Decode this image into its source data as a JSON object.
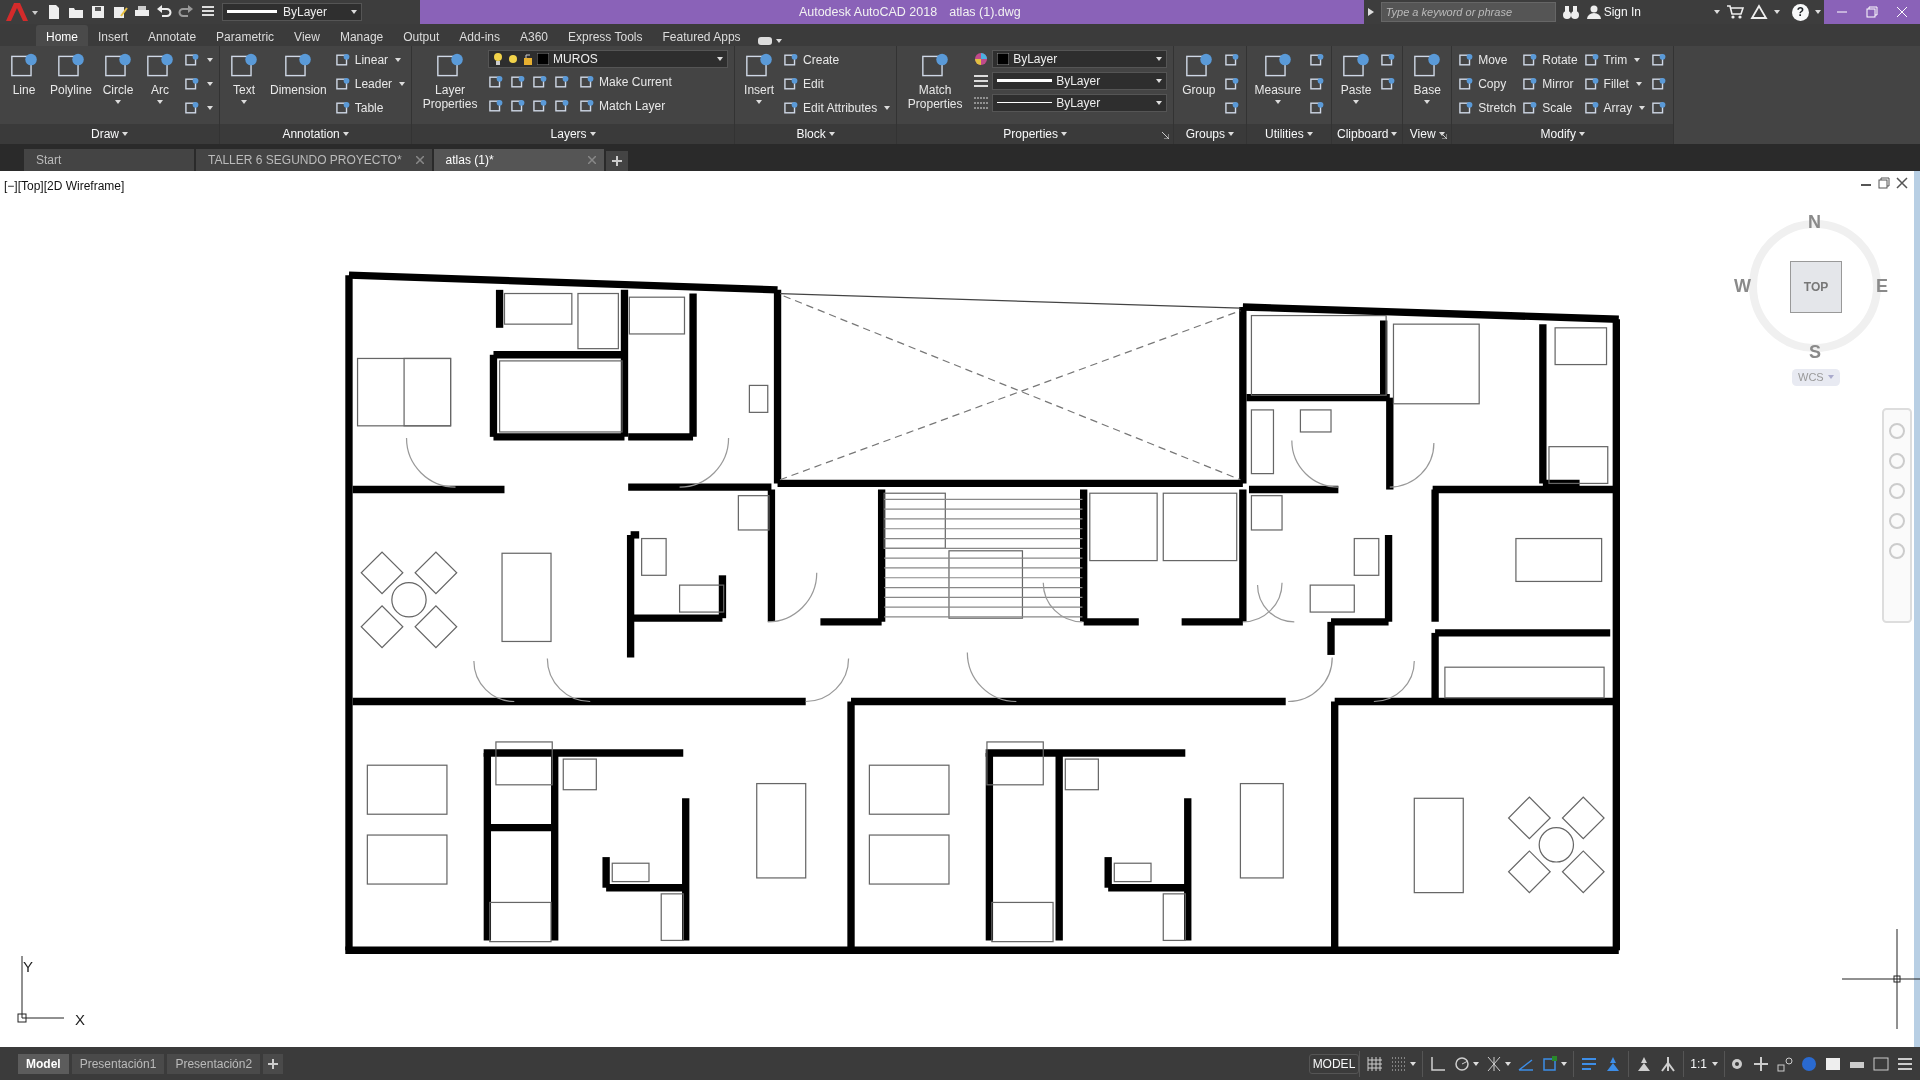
{
  "title_bar": {
    "layer_combo": "ByLayer",
    "app": "Autodesk AutoCAD 2018",
    "file": "atlas (1).dwg",
    "search": {
      "placeholder": "Type a keyword or phrase"
    },
    "sign_in": "Sign In",
    "help": "?"
  },
  "ribbon_tabs": [
    {
      "label": "Home",
      "selected": true
    },
    {
      "label": "Insert",
      "selected": false
    },
    {
      "label": "Annotate",
      "selected": false
    },
    {
      "label": "Parametric",
      "selected": false
    },
    {
      "label": "View",
      "selected": false
    },
    {
      "label": "Manage",
      "selected": false
    },
    {
      "label": "Output",
      "selected": false
    },
    {
      "label": "Add-ins",
      "selected": false
    },
    {
      "label": "A360",
      "selected": false
    },
    {
      "label": "Express Tools",
      "selected": false
    },
    {
      "label": "Featured Apps",
      "selected": false
    }
  ],
  "panels": [
    {
      "title": "Draw",
      "launcher": false,
      "columns": [
        {
          "kind": "large",
          "label": "Line",
          "dropdown": false
        },
        {
          "kind": "large",
          "label": "Polyline",
          "dropdown": false
        },
        {
          "kind": "large",
          "label": "Circle",
          "dropdown": true
        },
        {
          "kind": "large",
          "label": "Arc",
          "dropdown": true
        },
        {
          "kind": "stack",
          "items": [
            {
              "dropdown": true
            },
            {
              "dropdown": true
            },
            {
              "dropdown": true
            }
          ]
        }
      ]
    },
    {
      "title": "Annotation",
      "launcher": false,
      "columns": [
        {
          "kind": "large",
          "label": "Text",
          "dropdown": true
        },
        {
          "kind": "large",
          "label": "Dimension",
          "dropdown": false
        },
        {
          "kind": "stack",
          "items": [
            {
              "label": "Linear",
              "dropdown": true
            },
            {
              "label": "Leader",
              "dropdown": true
            },
            {
              "label": "Table",
              "dropdown": false
            }
          ]
        }
      ]
    },
    {
      "title": "Layers",
      "launcher": false,
      "columns": [
        {
          "kind": "large",
          "label": "Layer Properties",
          "dropdown": false
        },
        {
          "kind": "layers",
          "combo": "MUROS",
          "items": [
            {
              "label": "Make Current"
            },
            {
              "label": "Match Layer"
            }
          ]
        }
      ]
    },
    {
      "title": "Block",
      "launcher": false,
      "columns": [
        {
          "kind": "large",
          "label": "Insert",
          "dropdown": true
        },
        {
          "kind": "stack",
          "items": [
            {
              "label": "Create",
              "dropdown": false
            },
            {
              "label": "Edit",
              "dropdown": false
            },
            {
              "label": "Edit Attributes",
              "dropdown": true
            }
          ]
        }
      ]
    },
    {
      "title": "Properties",
      "launcher": true,
      "columns": [
        {
          "kind": "large",
          "label": "Match Properties",
          "dropdown": false
        },
        {
          "kind": "props",
          "combos": [
            {
              "kind": "color",
              "value": "ByLayer"
            },
            {
              "kind": "lineweight",
              "value": "ByLayer"
            },
            {
              "kind": "linetype",
              "value": "ByLayer"
            }
          ]
        }
      ]
    },
    {
      "title": "Groups",
      "launcher": false,
      "columns": [
        {
          "kind": "large",
          "label": "Group",
          "dropdown": false
        },
        {
          "kind": "stack",
          "items": [
            {
              "dropdown": false
            },
            {
              "dropdown": false
            },
            {
              "dropdown": false
            }
          ]
        }
      ]
    },
    {
      "title": "Utilities",
      "launcher": false,
      "columns": [
        {
          "kind": "large",
          "label": "Measure",
          "dropdown": true
        },
        {
          "kind": "stack",
          "items": [
            {
              "dropdown": false
            },
            {
              "dropdown": false
            },
            {
              "dropdown": false
            }
          ]
        }
      ]
    },
    {
      "title": "Clipboard",
      "launcher": false,
      "columns": [
        {
          "kind": "large",
          "label": "Paste",
          "dropdown": true
        },
        {
          "kind": "stack",
          "items": [
            {
              "dropdown": false
            },
            {
              "dropdown": false
            }
          ]
        }
      ]
    },
    {
      "title": "View",
      "launcher": true,
      "columns": [
        {
          "kind": "large",
          "label": "Base",
          "dropdown": true
        }
      ]
    },
    {
      "title": "Modify",
      "launcher": false,
      "columns": [
        {
          "kind": "stack",
          "items": [
            {
              "label": "Move",
              "dropdown": false
            },
            {
              "label": "Copy",
              "dropdown": false
            },
            {
              "label": "Stretch",
              "dropdown": false
            }
          ]
        },
        {
          "kind": "stack",
          "items": [
            {
              "label": "Rotate",
              "dropdown": false
            },
            {
              "label": "Mirror",
              "dropdown": false
            },
            {
              "label": "Scale",
              "dropdown": false
            }
          ]
        },
        {
          "kind": "stack",
          "items": [
            {
              "label": "Trim",
              "dropdown": true
            },
            {
              "label": "Fillet",
              "dropdown": true
            },
            {
              "label": "Array",
              "dropdown": true
            }
          ]
        },
        {
          "kind": "stack",
          "items": [
            {
              "dropdown": false
            },
            {
              "dropdown": false
            },
            {
              "dropdown": false
            }
          ]
        }
      ]
    }
  ],
  "file_tabs": [
    {
      "label": "Start",
      "selected": false,
      "closable": false
    },
    {
      "label": "TALLER 6 SEGUNDO PROYECTO*",
      "selected": false,
      "closable": true
    },
    {
      "label": "atlas (1)*",
      "selected": true,
      "closable": true
    }
  ],
  "viewport": {
    "label": "[−][Top][2D Wireframe]",
    "viewcube": {
      "north": "N",
      "south": "S",
      "east": "E",
      "west": "W",
      "face": "TOP",
      "ucs": "WCS"
    },
    "axes": {
      "y": "Y",
      "x": "X"
    }
  },
  "layout_tabs": [
    {
      "label": "Model",
      "selected": true
    },
    {
      "label": "Presentación1",
      "selected": false
    },
    {
      "label": "Presentación2",
      "selected": false
    }
  ],
  "status_bar": {
    "space": "MODEL",
    "scale": "1:1",
    "toggles": [
      {
        "kind": "grid",
        "on": false,
        "dropdown": false
      },
      {
        "kind": "snap",
        "on": false,
        "dropdown": true
      },
      {
        "kind": "ortho",
        "on": false,
        "dropdown": false
      },
      {
        "kind": "polar",
        "on": false,
        "dropdown": true
      },
      {
        "kind": "iso",
        "on": false,
        "dropdown": true
      },
      {
        "kind": "track",
        "on": true,
        "dropdown": false
      },
      {
        "kind": "osnap",
        "on": true,
        "dropdown": true
      },
      {
        "kind": "lineweight",
        "on": true,
        "dropdown": false
      },
      {
        "kind": "annovis",
        "on": true,
        "dropdown": false
      },
      {
        "kind": "autoscale",
        "on": false,
        "dropdown": false
      },
      {
        "kind": "annoscale",
        "on": false,
        "dropdown": false
      }
    ]
  }
}
